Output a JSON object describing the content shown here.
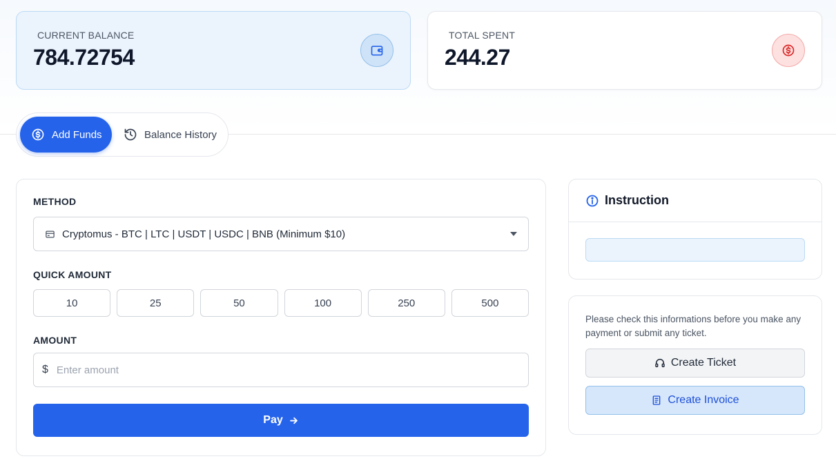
{
  "stats": {
    "balance": {
      "label": "CURRENT BALANCE",
      "value": "784.72754",
      "icon": "wallet-icon"
    },
    "spent": {
      "label": "TOTAL SPENT",
      "value": "244.27",
      "icon": "dollar-circle-icon"
    }
  },
  "tabs": [
    {
      "label": "Add Funds",
      "icon": "dollar-circle-icon",
      "active": true
    },
    {
      "label": "Balance History",
      "icon": "history-icon",
      "active": false
    }
  ],
  "form": {
    "method_label": "METHOD",
    "method_value": "Cryptomus - BTC | LTC | USDT | USDC | BNB (Minimum $10)",
    "quick_label": "QUICK AMOUNT",
    "quick_amounts": [
      "10",
      "25",
      "50",
      "100",
      "250",
      "500"
    ],
    "amount_label": "AMOUNT",
    "currency_symbol": "$",
    "amount_placeholder": "Enter amount",
    "amount_value": "",
    "pay_label": "Pay"
  },
  "instruction": {
    "title": "Instruction",
    "icon": "info-icon"
  },
  "help": {
    "text": "Please check this informations before you make any payment or submit any ticket.",
    "ticket_label": "Create Ticket",
    "invoice_label": "Create Invoice"
  },
  "colors": {
    "accent": "#2563eb",
    "balance_bg": "#ebf4fd",
    "spent_icon_bg": "#fde0e0",
    "spent_icon": "#dc2626"
  }
}
